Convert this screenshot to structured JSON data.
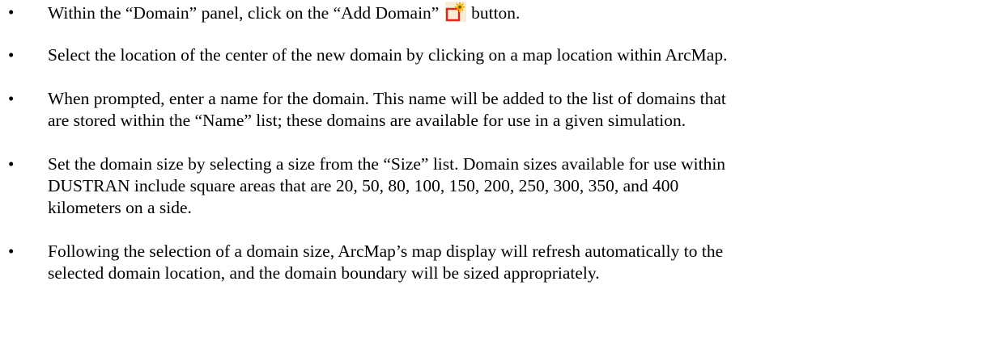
{
  "bullets": [
    {
      "lines": [
        "Within the “Domain” panel, click on the “Add Domain” ",
        " button."
      ],
      "icon": "add-domain-icon"
    },
    {
      "lines": [
        "Select the location of the center of the new domain by clicking on a map location within ArcMap."
      ]
    },
    {
      "lines": [
        "When prompted, enter a name for the domain.  This name will be added to the list of domains that",
        "are stored within the “Name” list; these domains are available for use in a given simulation."
      ]
    },
    {
      "lines": [
        "Set the domain size by selecting a size from the “Size” list.  Domain sizes available for use within",
        "DUSTRAN include square areas that are 20, 50, 80, 100, 150, 200, 250, 300, 350, and 400",
        "kilometers on a side."
      ]
    },
    {
      "lines": [
        "Following the selection of a domain size, ArcMap’s map display will refresh automatically to the",
        "selected domain location, and the domain boundary will be sized appropriately."
      ]
    }
  ],
  "bullet_glyph": "•",
  "colors": {
    "icon_border": "#e0251b",
    "icon_spark": "#f2b600",
    "icon_bg": "#f7ecd8"
  }
}
